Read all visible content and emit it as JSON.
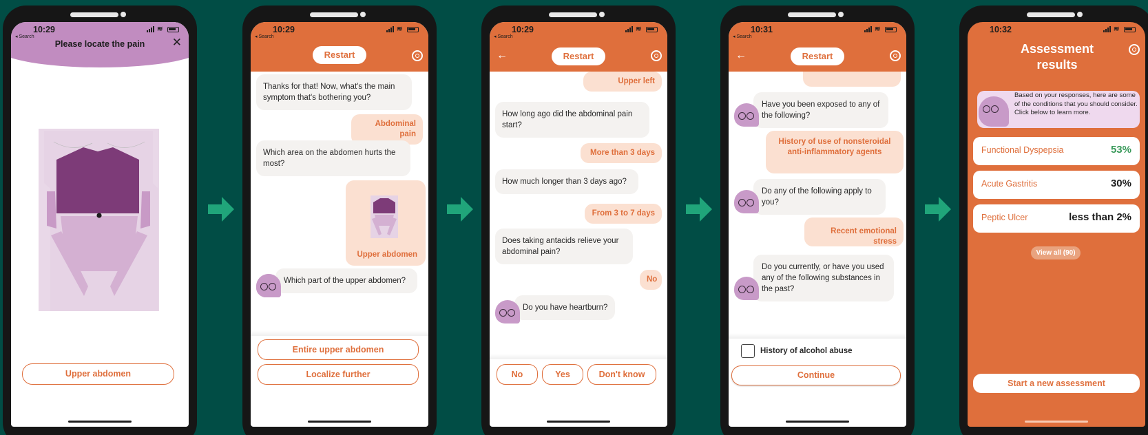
{
  "colors": {
    "background": "#014d45",
    "accent": "#df6f3c",
    "arrow": "#20a57a",
    "purple": "#c18cc0"
  },
  "screen1": {
    "time": "10:29",
    "back_label": "◂ Search",
    "title": "Please locate the pain",
    "close_icon": "close-icon",
    "button": "Upper abdomen"
  },
  "screen2": {
    "time": "10:29",
    "back_label": "◂ Search",
    "restart": "Restart",
    "messages": [
      {
        "from": "bot",
        "text": "Thanks for that! Now, what's the main symptom that's bothering you?"
      },
      {
        "from": "user",
        "text": "Abdominal pain"
      },
      {
        "from": "bot",
        "text": "Which area on the abdomen hurts the most?"
      },
      {
        "from": "user",
        "text": "Upper abdomen"
      },
      {
        "from": "bot",
        "text": "Which part of the upper abdomen?"
      }
    ],
    "options": [
      "Entire upper abdomen",
      "Localize further"
    ]
  },
  "screen3": {
    "time": "10:29",
    "back_label": "◂ Search",
    "restart": "Restart",
    "messages": [
      {
        "from": "user",
        "text": "Upper left"
      },
      {
        "from": "bot",
        "text": "How long ago did the abdominal pain start?"
      },
      {
        "from": "user",
        "text": "More than 3 days"
      },
      {
        "from": "bot",
        "text": "How much longer than 3 days ago?"
      },
      {
        "from": "user",
        "text": "From 3 to 7 days"
      },
      {
        "from": "bot",
        "text": "Does taking antacids relieve your abdominal pain?"
      },
      {
        "from": "user",
        "text": "No"
      },
      {
        "from": "bot",
        "text": "Do you have heartburn?"
      }
    ],
    "options": [
      "No",
      "Yes",
      "Don't know"
    ]
  },
  "screen4": {
    "time": "10:31",
    "back_label": "◂ Search",
    "restart": "Restart",
    "messages": [
      {
        "from": "bot",
        "text": "Have you been exposed to any of the following?"
      },
      {
        "from": "user",
        "text": "History of use of nonsteroidal anti-inflammatory agents"
      },
      {
        "from": "bot",
        "text": "Do any of the following apply to you?"
      },
      {
        "from": "user",
        "text": "Recent emotional stress"
      },
      {
        "from": "bot",
        "text": "Do you currently, or have you used any of the following substances in the past?"
      }
    ],
    "checkbox_label": "History of alcohol abuse",
    "continue": "Continue"
  },
  "screen5": {
    "time": "10:32",
    "title": "Assessment results",
    "intro": "Based on your responses, here are some of the conditions that you should consider. Click below to learn more.",
    "results": [
      {
        "name": "Functional Dyspepsia",
        "pct": "53%",
        "color": "#3a9a5b"
      },
      {
        "name": "Acute Gastritis",
        "pct": "30%",
        "color": "#1d1d1d"
      },
      {
        "name": "Peptic Ulcer",
        "pct": "less than 2%",
        "color": "#1d1d1d"
      }
    ],
    "view_all": "View all (90)",
    "new_assessment": "Start a new assessment"
  }
}
